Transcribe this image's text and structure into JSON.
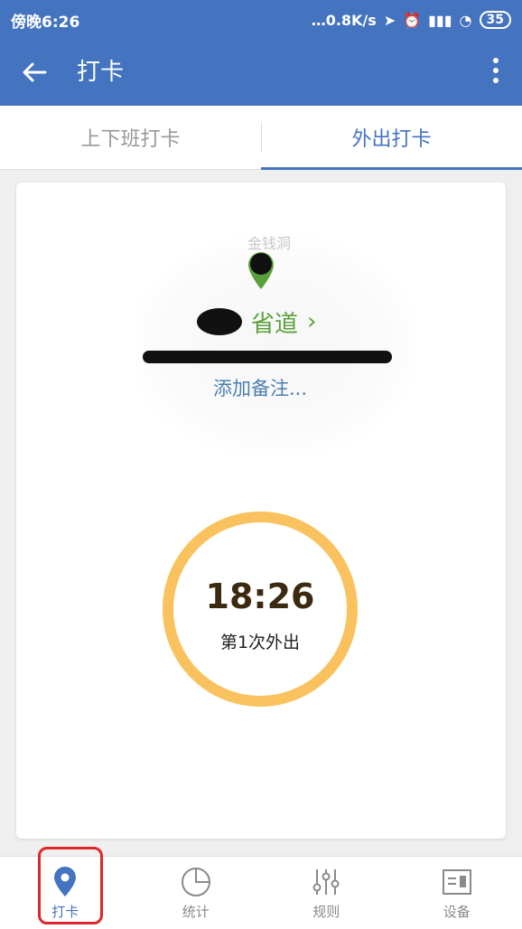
{
  "status_bar": {
    "time": "傍晚6:26",
    "speed": "…0.8K/s",
    "battery": "35"
  },
  "app_bar": {
    "title": "打卡"
  },
  "tabs": [
    {
      "label": "上下班打卡",
      "active": false
    },
    {
      "label": "外出打卡",
      "active": true
    }
  ],
  "map": {
    "label": "金钱洞",
    "location_name": "省道",
    "add_note": "添加备注..."
  },
  "punch": {
    "time": "18:26",
    "count_label": "第1次外出"
  },
  "bottom_nav": [
    {
      "label": "打卡",
      "icon": "location-pin-icon",
      "active": true
    },
    {
      "label": "统计",
      "icon": "pie-chart-icon",
      "active": false
    },
    {
      "label": "规则",
      "icon": "sliders-icon",
      "active": false
    },
    {
      "label": "设备",
      "icon": "device-icon",
      "active": false
    }
  ],
  "colors": {
    "primary": "#4473c0",
    "ring": "#f9c25f",
    "location_green": "#5aa03a",
    "highlight_red": "#e1262a"
  }
}
